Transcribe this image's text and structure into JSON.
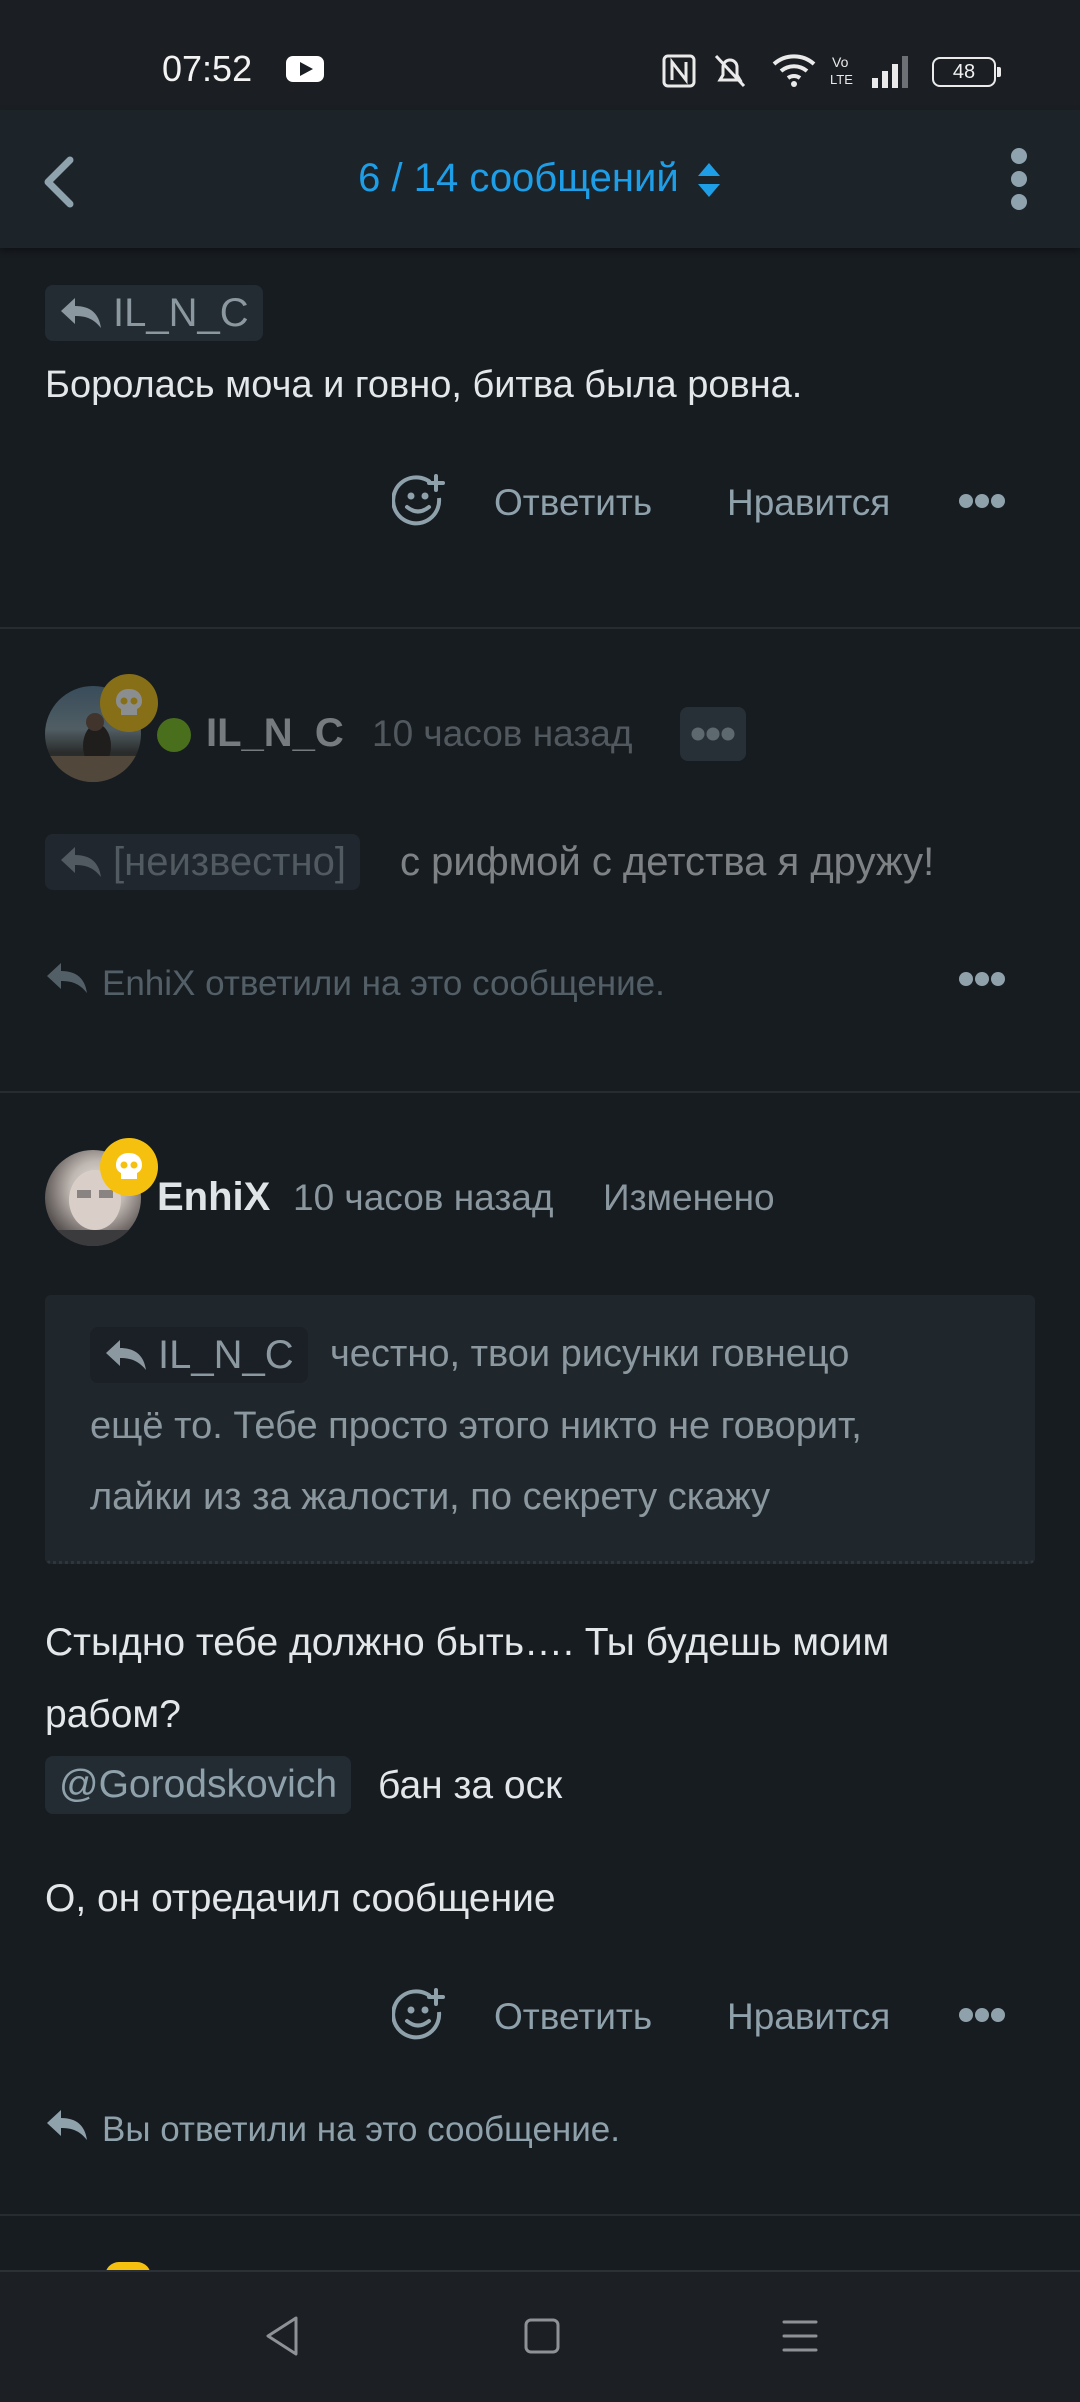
{
  "status": {
    "time": "07:52",
    "battery": "48"
  },
  "header": {
    "title": "6 / 14 сообщений"
  },
  "messages": [
    {
      "reply_to": "IL_N_C",
      "text": "Боролась моча и говно, битва была ровна.",
      "actions": {
        "reply": "Ответить",
        "like": "Нравится"
      }
    },
    {
      "author": "IL_N_C",
      "time": "10 часов назад",
      "reply_to": "[неизвестно]",
      "text": "с рифмой с детства я дружу!",
      "replied_note": "EnhiX ответили на это сообщение."
    },
    {
      "author": "EnhiX",
      "time": "10 часов назад",
      "edited": "Изменено",
      "quote": {
        "reply_to": "IL_N_C",
        "line1": "честно, твои рисунки говнецо",
        "line2": "ещё то. Тебе просто этого никто не говорит,",
        "line3": "лайки из за жалости, по секрету скажу"
      },
      "text_line1": "Стыдно тебе должно быть…. Ты будешь моим",
      "text_line2": "рабом?",
      "mention": "@Gorodskovich",
      "mention_text": "бан за оск",
      "text_line3": "О, он отредачил сообщение",
      "actions": {
        "reply": "Ответить",
        "like": "Нравится"
      },
      "replied_note": "Вы ответили на это сообщение."
    }
  ],
  "colors": {
    "accent": "#1f9ee8",
    "background": "#171c21",
    "online": "#7cc219",
    "badge": "#f6c10e"
  }
}
